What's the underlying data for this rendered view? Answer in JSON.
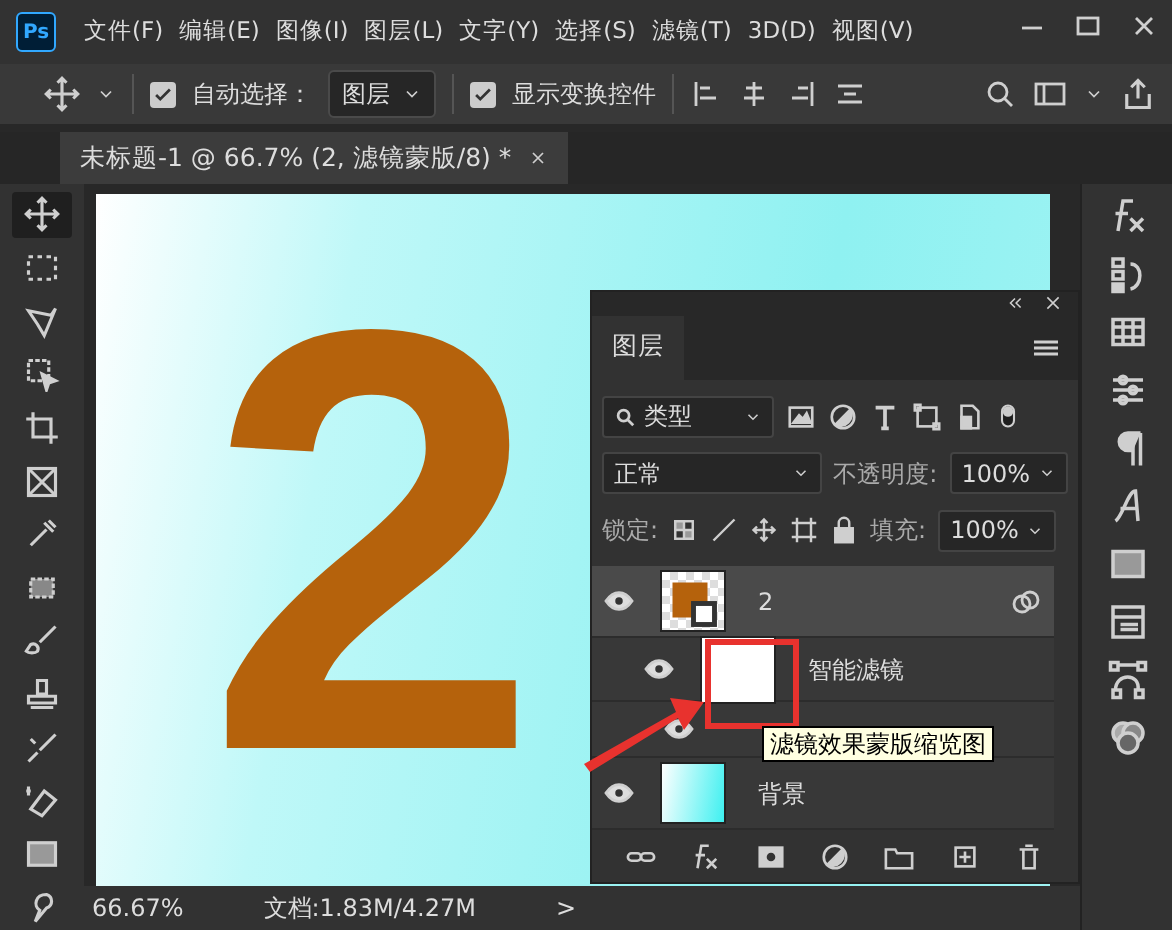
{
  "app": {
    "logo": "Ps"
  },
  "menu": [
    "文件(F)",
    "编辑(E)",
    "图像(I)",
    "图层(L)",
    "文字(Y)",
    "选择(S)",
    "滤镜(T)",
    "3D(D)",
    "视图(V)"
  ],
  "options_bar": {
    "auto_select": {
      "label": "自动选择：",
      "checked": true
    },
    "auto_select_target": "图层",
    "show_transform": {
      "label": "显示变换控件",
      "checked": true
    }
  },
  "document_tab": {
    "title": "未标题-1 @ 66.7% (2, 滤镜蒙版/8) *",
    "selected": true
  },
  "tools": [
    {
      "selected": true
    },
    {
      "selected": false
    },
    {
      "selected": false
    },
    {
      "selected": false
    },
    {
      "selected": false
    },
    {
      "selected": false
    },
    {
      "selected": false
    },
    {
      "selected": false
    },
    {
      "selected": false
    },
    {
      "selected": false
    },
    {
      "selected": false
    },
    {
      "selected": false
    },
    {
      "selected": false
    },
    {
      "selected": false
    }
  ],
  "canvas": {
    "text": "2"
  },
  "layers_panel": {
    "tab": "图层",
    "filter_kind": "类型",
    "filter_on": true,
    "blend_mode": "正常",
    "opacity_label": "不透明度:",
    "opacity": "100%",
    "lock_label": "锁定:",
    "fill_label": "填充:",
    "fill": "100%",
    "layers": [
      {
        "kind": "smart",
        "name": "2",
        "visible": true,
        "selected": true
      },
      {
        "kind": "filter-mask",
        "name": "智能滤镜",
        "visible": true,
        "selected": false
      },
      {
        "kind": "filter",
        "visible": true,
        "selected": false
      },
      {
        "kind": "background",
        "name": "背景",
        "visible": true,
        "selected": false
      }
    ]
  },
  "tooltip": "滤镜效果蒙版缩览图",
  "status_bar": {
    "zoom": "66.67%",
    "doc": "文档:1.83M/4.27M",
    "arrow": ">"
  }
}
